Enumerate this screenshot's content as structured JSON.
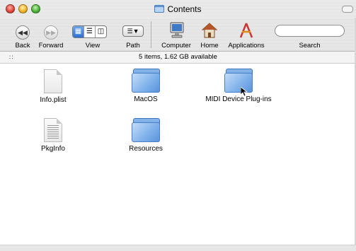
{
  "window": {
    "title": "Contents",
    "buttons": {
      "close": "close",
      "minimize": "minimize",
      "zoom": "zoom"
    }
  },
  "toolbar": {
    "back_label": "Back",
    "forward_label": "Forward",
    "view_label": "View",
    "path_label": "Path",
    "computer_label": "Computer",
    "home_label": "Home",
    "applications_label": "Applications",
    "search_label": "Search",
    "search_value": "",
    "view_modes": [
      "icon",
      "list",
      "column"
    ],
    "selected_view": "icon"
  },
  "status": {
    "text": "5 items, 1.62 GB available"
  },
  "items": [
    {
      "name": "Info.plist",
      "kind": "document",
      "icon": "plist-document-icon"
    },
    {
      "name": "MacOS",
      "kind": "folder",
      "icon": "folder-icon"
    },
    {
      "name": "MIDI Device Plug-ins",
      "kind": "folder",
      "icon": "folder-icon"
    },
    {
      "name": "PkgInfo",
      "kind": "document",
      "icon": "text-document-icon"
    },
    {
      "name": "Resources",
      "kind": "folder",
      "icon": "folder-icon"
    }
  ],
  "colors": {
    "accent": "#2f6fd0",
    "folder": "#7eb0ea"
  }
}
